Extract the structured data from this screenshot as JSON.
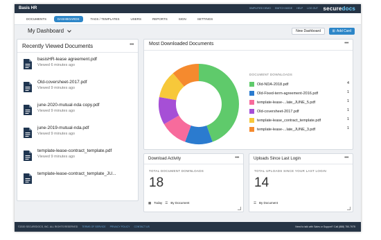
{
  "topbar": {
    "app_name": "Basis HR",
    "links": [
      "SIMPLIFIED DEMO",
      "SWITCH MODE",
      "HELP",
      "LOG OUT"
    ],
    "brand_a": "secure",
    "brand_b": "docs"
  },
  "nav": [
    "DOCUMENTS",
    "DASHBOARDS",
    "TAGS / TEMPLATES",
    "USERS",
    "REPORTS",
    "SIGN",
    "SETTINGS"
  ],
  "header": {
    "title": "My Dashboard",
    "new_dashboard": "New Dashboard",
    "add_card": "Add Card"
  },
  "recent": {
    "title": "Recently Viewed Documents",
    "items": [
      {
        "name": "basisHR-lease agreement.pdf",
        "time": "Viewed 6 minutes ago"
      },
      {
        "name": "Old-coversheet-2017.pdf",
        "time": "Viewed 9 minutes ago"
      },
      {
        "name": "june-2020-mutual-nda copy.pdf",
        "time": "Viewed 9 minutes ago"
      },
      {
        "name": "june-2019-mutual-nda.pdf",
        "time": "Viewed 9 minutes ago"
      },
      {
        "name": "template-lease-contract_template.pdf",
        "time": "Viewed 9 minutes ago"
      },
      {
        "name": "template-lease-contract_template_JU...",
        "time": ""
      }
    ]
  },
  "downloads": {
    "title": "Most Downloaded Documents",
    "legend_head": "DOCUMENT DOWNLOADS",
    "items": [
      {
        "name": "Old-NDA-2018.pdf",
        "count": "4",
        "value": 4,
        "color": "#5fca6b"
      },
      {
        "name": "Old-Fixed-term-agreement-2016.pdf",
        "count": "1",
        "value": 1,
        "color": "#2b7bcf"
      },
      {
        "name": "template-lease-...late_JUNE_5.pdf",
        "count": "1",
        "value": 1,
        "color": "#f76b9c"
      },
      {
        "name": "Old-coversheet-2017.pdf",
        "count": "1",
        "value": 1,
        "color": "#a64fd6"
      },
      {
        "name": "template-lease_contract_template.pdf",
        "count": "1",
        "value": 1,
        "color": "#f7c83a"
      },
      {
        "name": "template-lease-...late_JUNE_3.pdf",
        "count": "1",
        "value": 1,
        "color": "#f58a2e"
      }
    ]
  },
  "activity": {
    "title": "Download Activity",
    "label": "TOTAL DOCUMENT DOWNLOADS",
    "value": "18",
    "foot_a": "Today",
    "foot_b": "By Document"
  },
  "uploads": {
    "title": "Uploads Since Last Login",
    "label": "TOTAL UPLOADS SINCE YOUR LAST LOGIN",
    "value": "14",
    "foot_b": "By Document"
  },
  "footer": {
    "copyright": "©2020 SECUREDOCS, INC. ALL RIGHTS RESERVED",
    "links": [
      "TERMS OF SERVICE",
      "PRIVACY POLICY",
      "CONTACT US"
    ],
    "help": "Need to talk with Sales or Support? Call (888) 750-7975"
  },
  "colors": {
    "accent": "#2d86c8",
    "topbar": "#263445"
  }
}
